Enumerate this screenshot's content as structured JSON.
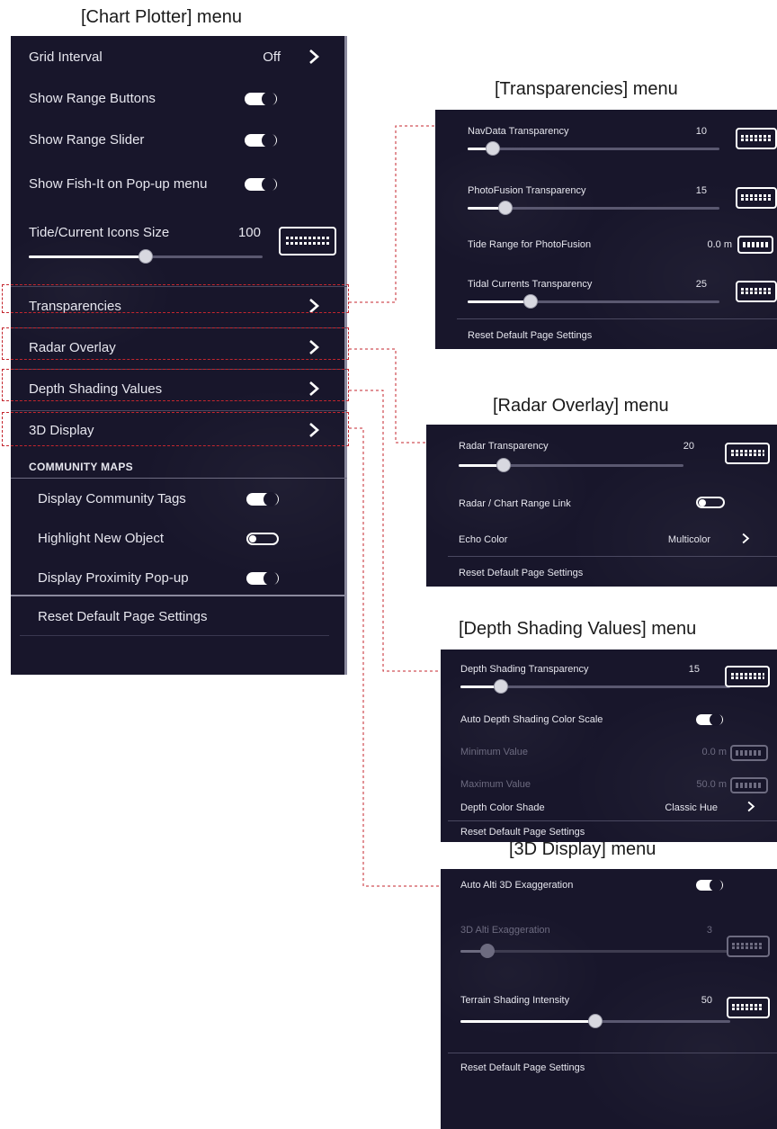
{
  "captions": {
    "chart_plotter": "[Chart Plotter] menu",
    "transparencies": "[Transparencies] menu",
    "radar_overlay": "[Radar Overlay] menu",
    "depth_shading": "[Depth Shading Values] menu",
    "display_3d": "[3D Display] menu"
  },
  "chart_plotter": {
    "grid_interval": {
      "label": "Grid Interval",
      "value": "Off"
    },
    "show_range_buttons": {
      "label": "Show Range Buttons",
      "state": "on"
    },
    "show_range_slider": {
      "label": "Show Range Slider",
      "state": "on"
    },
    "show_fish_it": {
      "label": "Show Fish-It on Pop-up menu",
      "state": "on"
    },
    "tide_current_icons_size": {
      "label": "Tide/Current Icons Size",
      "value": "100",
      "level": 0.5
    },
    "transparencies": "Transparencies",
    "radar_overlay": "Radar Overlay",
    "depth_shading_values": "Depth Shading Values",
    "display_3d": "3D Display",
    "community_maps_header": "COMMUNITY MAPS",
    "display_community_tags": {
      "label": "Display Community Tags",
      "state": "on"
    },
    "highlight_new_object": {
      "label": "Highlight New Object",
      "state": "off"
    },
    "display_proximity_popup": {
      "label": "Display Proximity Pop-up",
      "state": "on"
    },
    "reset": "Reset Default Page Settings"
  },
  "transparencies": {
    "navdata": {
      "label": "NavData Transparency",
      "value": "10",
      "level": 0.1
    },
    "photofusion": {
      "label": "PhotoFusion Transparency",
      "value": "15",
      "level": 0.15
    },
    "tide_range": {
      "label": "Tide Range for PhotoFusion",
      "value": "0.0 m"
    },
    "tidal_currents": {
      "label": "Tidal Currents Transparency",
      "value": "25",
      "level": 0.25
    },
    "reset": "Reset Default Page Settings"
  },
  "radar_overlay": {
    "radar_transparency": {
      "label": "Radar Transparency",
      "value": "20",
      "level": 0.2
    },
    "range_link": {
      "label": "Radar / Chart Range Link",
      "state": "off"
    },
    "echo_color": {
      "label": "Echo Color",
      "value": "Multicolor"
    },
    "reset": "Reset Default Page Settings"
  },
  "depth_shading": {
    "transparency": {
      "label": "Depth Shading Transparency",
      "value": "15",
      "level": 0.15
    },
    "auto_scale": {
      "label": "Auto Depth Shading Color Scale",
      "state": "on"
    },
    "minimum": {
      "label": "Minimum Value",
      "value": "0.0 m"
    },
    "maximum": {
      "label": "Maximum Value",
      "value": "50.0 m"
    },
    "color_shade": {
      "label": "Depth Color Shade",
      "value": "Classic Hue"
    },
    "reset": "Reset Default Page Settings"
  },
  "display_3d": {
    "auto_exaggeration": {
      "label": "Auto Alti 3D Exaggeration",
      "state": "on"
    },
    "exaggeration": {
      "label": "3D Alti Exaggeration",
      "value": "3",
      "level": 0.1
    },
    "terrain_shading": {
      "label": "Terrain Shading Intensity",
      "value": "50",
      "level": 0.5
    },
    "reset": "Reset Default Page Settings"
  },
  "colors": {
    "panel_bg": "#18162b",
    "highlight": "#c4262e",
    "disabled_text": "#6d6b80"
  }
}
